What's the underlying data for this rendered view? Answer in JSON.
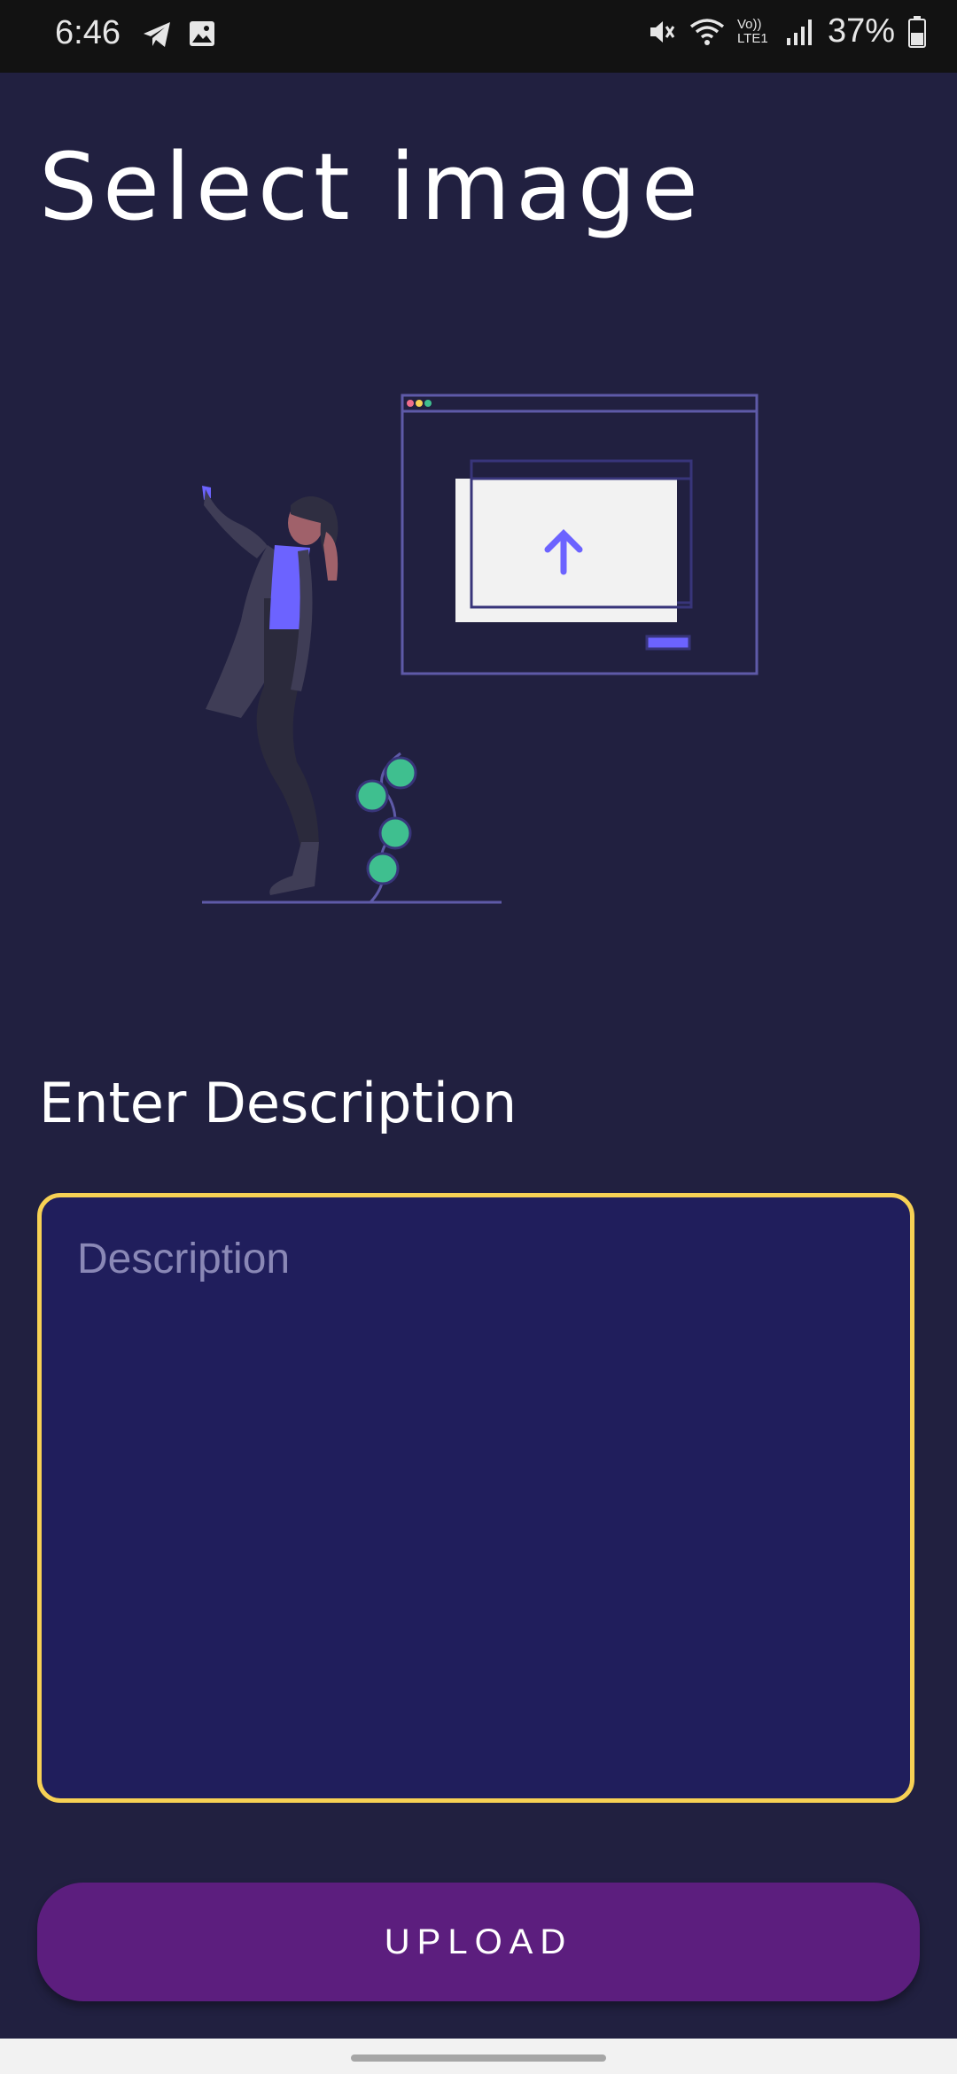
{
  "status_bar": {
    "time": "6:46",
    "battery_percent": "37%",
    "network_label": "Vo)) LTE1",
    "icons": [
      "telegram-icon",
      "gallery-icon",
      "mute-icon",
      "wifi-icon",
      "lte-icon",
      "signal-icon",
      "battery-icon"
    ]
  },
  "page": {
    "title": "Select image",
    "description_label": "Enter Description",
    "description_placeholder": "Description",
    "upload_label": "UPLOAD"
  },
  "colors": {
    "background": "#212040",
    "accent_purple": "#6c63ff",
    "input_border": "#f7d154",
    "input_fill": "#201e5c",
    "button_fill": "#5c1e7e",
    "plant_green": "#3fbf8f"
  }
}
